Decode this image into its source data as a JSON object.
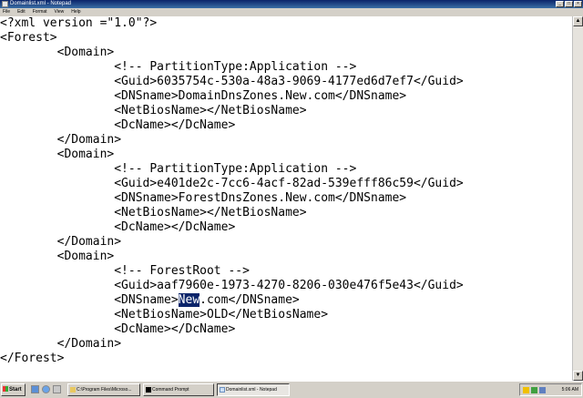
{
  "window": {
    "title": "Domainlist.xml - Notepad",
    "minimize": "_",
    "maximize": "□",
    "close": "×"
  },
  "menu": [
    "File",
    "Edit",
    "Format",
    "View",
    "Help"
  ],
  "editor": {
    "lines": [
      "<?xml version =\"1.0\"?>",
      "<Forest>",
      "        <Domain>",
      "                <!-- PartitionType:Application -->",
      "                <Guid>6035754c-530a-48a3-9069-4177ed6d7ef7</Guid>",
      "                <DNSname>DomainDnsZones.New.com</DNSname>",
      "                <NetBiosName></NetBiosName>",
      "                <DcName></DcName>",
      "        </Domain>",
      "        <Domain>",
      "                <!-- PartitionType:Application -->",
      "                <Guid>e401de2c-7cc6-4acf-82ad-539efff86c59</Guid>",
      "                <DNSname>ForestDnsZones.New.com</DNSname>",
      "                <NetBiosName></NetBiosName>",
      "                <DcName></DcName>",
      "        </Domain>",
      "        <Domain>",
      "                <!-- ForestRoot -->",
      "                <Guid>aaf7960e-1973-4270-8206-030e476f5e43</Guid>",
      "                <DNSname>",
      "                <NetBiosName>OLD</NetBiosName>",
      "                <DcName></DcName>",
      "        </Domain>",
      "</Forest>"
    ],
    "selected_text": "New",
    "after_selection": ".com</DNSname>"
  },
  "scrollbar": {
    "up": "▲",
    "down": "▼"
  },
  "taskbar": {
    "start_label": "Start",
    "tasks": [
      {
        "label": "C:\\Program Files\\Microso..."
      },
      {
        "label": "Command Prompt"
      },
      {
        "label": "Domainlist.xml - Notepad"
      }
    ],
    "clock": "5:06 AM"
  },
  "colors": {
    "title_bar": "#0a246a",
    "selection": "#0a246a",
    "chrome": "#d4d0c8"
  }
}
